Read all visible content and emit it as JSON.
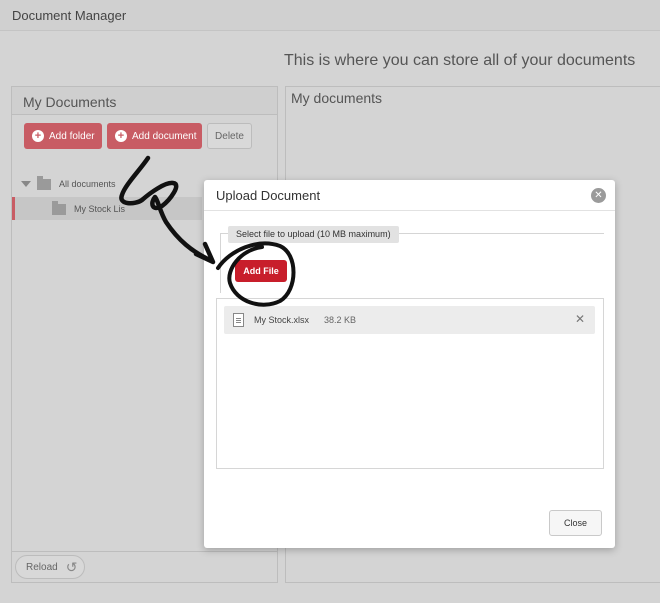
{
  "app": {
    "title": "Document Manager",
    "tagline": "This is where you can store all of your documents"
  },
  "left_panel": {
    "title": "My Documents",
    "buttons": {
      "add_folder": "Add folder",
      "add_document": "Add document",
      "delete": "Delete"
    },
    "tree": [
      {
        "label": "All documents"
      },
      {
        "label": "My Stock Lis"
      }
    ],
    "reload_label": "Reload"
  },
  "right_panel": {
    "title": "My documents"
  },
  "modal": {
    "title": "Upload Document",
    "legend": "Select file to upload (10 MB maximum)",
    "add_file_label": "Add File",
    "files": [
      {
        "name": "My Stock.xlsx",
        "size": "38.2 KB"
      }
    ],
    "close_label": "Close"
  },
  "icons": {
    "close": "close-x-icon",
    "reload": "reload-icon",
    "file": "document-icon",
    "folder": "folder-icon"
  },
  "colors": {
    "primary": "#c81e2b",
    "primary_dim": "#c85c64"
  }
}
